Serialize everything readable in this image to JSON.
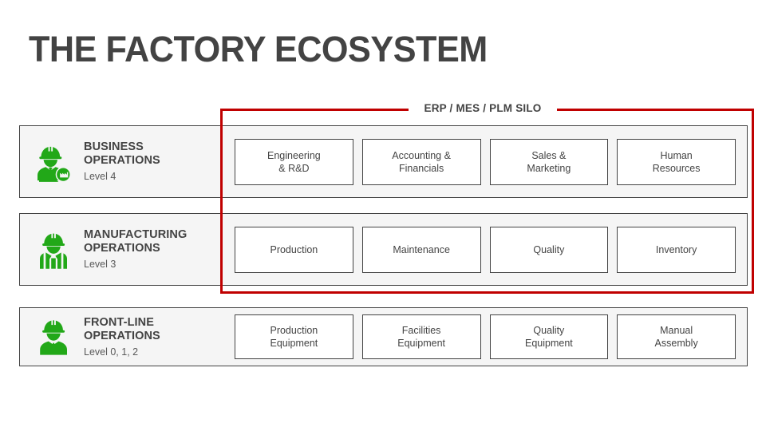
{
  "title": "THE FACTORY ECOSYSTEM",
  "silo": {
    "label": "ERP / MES / PLM SILO",
    "border_color": "#c00000"
  },
  "colors": {
    "green": "#22a818",
    "dark_gray": "#434343",
    "row_background": "#f5f5f5",
    "card_background": "#ffffff",
    "page_background": "#ffffff"
  },
  "rows": [
    {
      "id": "business-operations",
      "icon": "worker-with-factory-badge-icon",
      "title": "BUSINESS\nOPERATIONS",
      "level": "Level 4",
      "cards": [
        {
          "label": "Engineering\n& R&D"
        },
        {
          "label": "Accounting &\nFinancials"
        },
        {
          "label": "Sales &\nMarketing"
        },
        {
          "label": "Human\nResources"
        }
      ]
    },
    {
      "id": "manufacturing-operations",
      "icon": "worker-with-vest-icon",
      "title": "MANUFACTURING\nOPERATIONS",
      "level": "Level 3",
      "cards": [
        {
          "label": "Production"
        },
        {
          "label": "Maintenance"
        },
        {
          "label": "Quality"
        },
        {
          "label": "Inventory"
        }
      ]
    },
    {
      "id": "front-line-operations",
      "icon": "worker-icon",
      "title": "FRONT-LINE\nOPERATIONS",
      "level": "Level 0, 1, 2",
      "cards": [
        {
          "label": "Production\nEquipment"
        },
        {
          "label": "Facilities\nEquipment"
        },
        {
          "label": "Quality\nEquipment"
        },
        {
          "label": "Manual\nAssembly"
        }
      ]
    }
  ]
}
